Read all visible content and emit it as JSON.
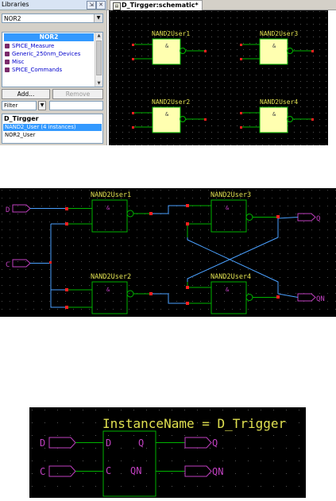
{
  "libraries": {
    "title": "Libraries",
    "selected_library": "NOR2",
    "list": {
      "selected": "NOR2",
      "items": [
        "SPICE_Measure",
        "Generic_250nm_Devices",
        "Misc",
        "SPICE_Commands"
      ]
    },
    "add_button": "Add...",
    "remove_button": "Remove",
    "filter_label": "Filter",
    "cells": {
      "header": "D_Tirgger",
      "selected": "NAND2_User (4 instances)",
      "item": "NOR2_User"
    }
  },
  "editor": {
    "tab_title": "D_Tirgger:schematic*"
  },
  "schematic_top": {
    "instances": [
      "NAND2User1",
      "NAND2User3",
      "NAND2User2",
      "NAND2User4"
    ],
    "gate_symbol": "&"
  },
  "schematic_middle": {
    "instances": [
      "NAND2User1",
      "NAND2User3",
      "NAND2User2",
      "NAND2User4"
    ],
    "gate_symbol": "&",
    "ports": {
      "in_d": "D",
      "in_c": "C",
      "out_q": "Q",
      "out_qn": "QN"
    }
  },
  "symbol": {
    "instance_name": "InstanceName = D_Trigger",
    "pins": {
      "d": "D",
      "c": "C",
      "q": "Q",
      "qn": "QN"
    },
    "ports": {
      "in_d": "D",
      "in_c": "C",
      "out_q": "Q",
      "out_qn": "QN"
    }
  },
  "colors": {
    "canvas_bg": "#000000",
    "gate_outline": "#00b400",
    "gate_fill": "#ffffb0",
    "wire": "#00b400",
    "crossing_wire": "#4aa0ff",
    "port": "#c040c0",
    "pin_red": "#ff2020",
    "instance_label": "#e0e050"
  }
}
